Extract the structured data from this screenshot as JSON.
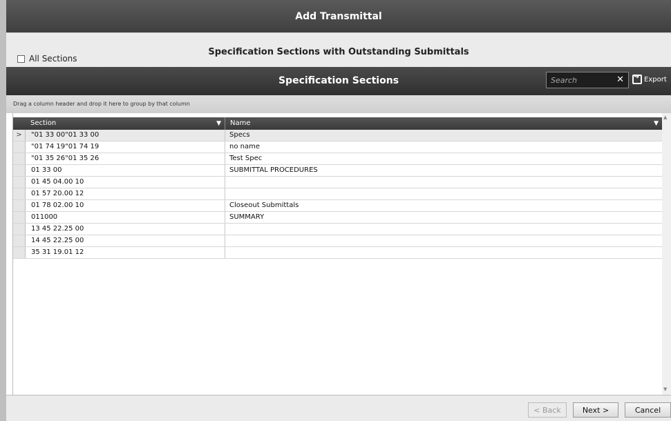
{
  "window": {
    "title": "Add Transmittal"
  },
  "filter": {
    "all_sections_label": "All Sections",
    "subtitle": "Specification Sections with Outstanding Submittals"
  },
  "toolbar": {
    "title": "Specification Sections",
    "search_placeholder": "Search",
    "export_label": "Export"
  },
  "grid": {
    "group_hint": "Drag a column header and drop it here to group by that column",
    "columns": {
      "section": "Section",
      "name": "Name"
    },
    "rows": [
      {
        "section": "\"01 33 00\"01 33 00",
        "name": "Specs"
      },
      {
        "section": "\"01 74 19\"01 74 19",
        "name": "no name"
      },
      {
        "section": "\"01 35 26\"01 35 26",
        "name": "Test Spec"
      },
      {
        "section": "01 33 00",
        "name": "SUBMITTAL PROCEDURES"
      },
      {
        "section": "01 45 04.00 10",
        "name": ""
      },
      {
        "section": "01 57 20.00 12",
        "name": ""
      },
      {
        "section": "01 78 02.00 10",
        "name": "Closeout Submittals"
      },
      {
        "section": "011000",
        "name": "SUMMARY"
      },
      {
        "section": "13 45 22.25 00",
        "name": ""
      },
      {
        "section": "14 45 22.25 00",
        "name": ""
      },
      {
        "section": "35 31 19.01 12",
        "name": ""
      }
    ],
    "row_indicator": ">"
  },
  "footer": {
    "back_label": "< Back",
    "next_label": "Next >",
    "cancel_label": "Cancel"
  },
  "icons": {
    "clear": "close-icon",
    "export": "export-icon",
    "filter": "filter-icon"
  }
}
